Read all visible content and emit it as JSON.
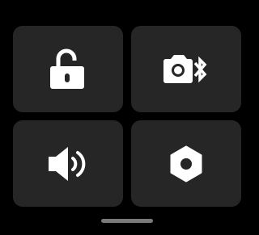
{
  "colors": {
    "background": "#000000",
    "tile": "#262626",
    "icon": "#ffffff",
    "home_indicator": "#7a7a7a"
  },
  "tiles": [
    {
      "icon": "unlock-icon"
    },
    {
      "icon": "camera-bluetooth-icon"
    },
    {
      "icon": "speaker-icon"
    },
    {
      "icon": "settings-hexagon-icon"
    }
  ]
}
